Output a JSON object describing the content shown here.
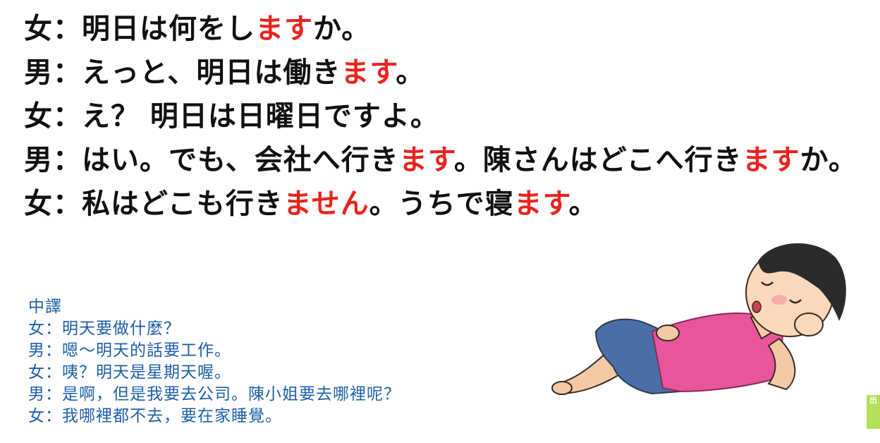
{
  "dialogue": [
    {
      "speaker": "女",
      "sep": "：",
      "parts": [
        {
          "text": "明日は何をし",
          "hl": false
        },
        {
          "text": "ます",
          "hl": true
        },
        {
          "text": "か。",
          "hl": false
        }
      ]
    },
    {
      "speaker": "男",
      "sep": "：",
      "parts": [
        {
          "text": "えっと、明日は働き",
          "hl": false
        },
        {
          "text": "ます",
          "hl": true
        },
        {
          "text": "。",
          "hl": false
        }
      ]
    },
    {
      "speaker": "女",
      "sep": "：",
      "parts": [
        {
          "text": "え？ 明日は日曜日ですよ。",
          "hl": false
        }
      ]
    },
    {
      "speaker": "男",
      "sep": "：",
      "parts": [
        {
          "text": "はい。でも、会社へ行き",
          "hl": false
        },
        {
          "text": "ます",
          "hl": true
        },
        {
          "text": "。陳さんはどこへ行き",
          "hl": false
        },
        {
          "text": "ます",
          "hl": true
        },
        {
          "text": "か。",
          "hl": false
        }
      ]
    },
    {
      "speaker": "女",
      "sep": "：",
      "parts": [
        {
          "text": "私はどこも行き",
          "hl": false
        },
        {
          "text": "ません",
          "hl": true
        },
        {
          "text": "。うちで寝",
          "hl": false
        },
        {
          "text": "ます",
          "hl": true
        },
        {
          "text": "。",
          "hl": false
        }
      ]
    }
  ],
  "translation": {
    "heading": "中譯",
    "lines": [
      "女：明天要做什麼？",
      "男：嗯～明天的話要工作。",
      "女：咦？明天是星期天喔。",
      "男：是啊，但是我要去公司。陳小姐要去哪裡呢？",
      "女：我哪裡都不去，要在家睡覺。"
    ]
  },
  "side_tab": {
    "label": "出"
  },
  "colors": {
    "text": "#111111",
    "highlight": "#e8231e",
    "translation": "#1c5fa8",
    "side_tab": "#b7e05a"
  },
  "illustration": {
    "icon": "sleeping-person-icon"
  }
}
